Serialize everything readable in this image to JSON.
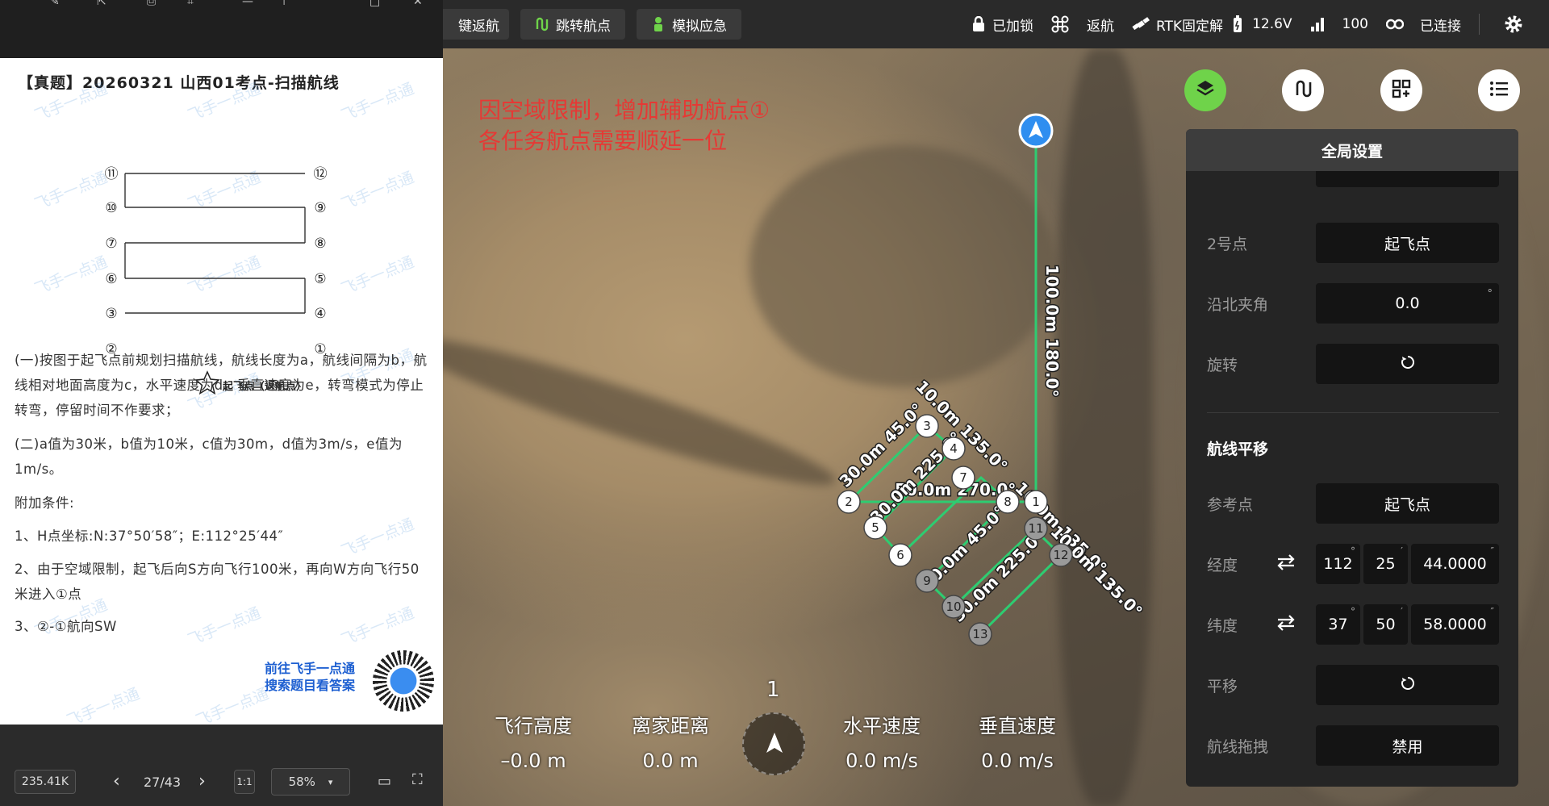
{
  "topbar": {
    "return_home": "键返航",
    "jump_waypoint": "跳转航点",
    "simulate_emergency": "模拟应急",
    "lock_status": "已加锁",
    "return_mode": "返航",
    "rtk_status": "RTK固定解",
    "battery_voltage": "12.6V",
    "signal_value": "100",
    "connection_status": "已连接"
  },
  "doc": {
    "title": "【真题】20260321 山西01考点-扫描航线",
    "takeoff_label": "起飞点（返航点）",
    "diagram_points": [
      "⑪",
      "⑫",
      "⑩",
      "⑨",
      "⑦",
      "⑧",
      "⑥",
      "⑤",
      "③",
      "④",
      "②",
      "①"
    ],
    "watermark": "飞手一点通",
    "paragraphs": [
      "(一)按图于起飞点前规划扫描航线，航线长度为a，航线间隔为b，航线相对地面高度为c，水平速度为d，垂直速度为e，转弯模式为停止转弯，停留时间不作要求；",
      "(二)a值为30米，b值为10米，c值为30m，d值为3m/s，e值为1m/s。",
      "附加条件:",
      "1、H点坐标:N:37°50′58″；E:112°25′44″",
      "2、由于空域限制，起飞后向S方向飞行100米，再向W方向飞行50米进入①点",
      "3、②-①航向SW"
    ],
    "qr_line1": "前往飞手一点通",
    "qr_line2": "搜索题目看答案",
    "file_size": "235.41K",
    "page_indicator": "27/43",
    "zoom": "58%"
  },
  "map_note": {
    "line1": "因空域限制，增加辅助航点①",
    "line2": "各任务航点需要顺延一位"
  },
  "route_labels": {
    "main_leg": "100.0m 180.0°",
    "leg_a": "30.0m 45.0°",
    "leg_b": "10.0m 135.0°",
    "leg_c": "50.0m 270.0°",
    "leg_d": "30.0m 225.0°",
    "leg_e": "10.0m 135.0°",
    "leg_f": "30.0m 45.0°",
    "leg_g": "30.0m 225.0°",
    "leg_h": "10.0m 135.0°"
  },
  "waypoints": [
    "1",
    "2",
    "3",
    "4",
    "5",
    "6",
    "7",
    "8",
    "9",
    "10",
    "11",
    "12",
    "13"
  ],
  "telemetry": {
    "altitude_label": "飞行高度",
    "altitude_value": "–0.0 m",
    "distance_label": "离家距离",
    "distance_value": "0.0 m",
    "hspeed_label": "水平速度",
    "hspeed_value": "0.0 m/s",
    "vspeed_label": "垂直速度",
    "vspeed_value": "0.0 m/s",
    "compass_number": "1"
  },
  "panel": {
    "title": "全局设置",
    "point2_label": "2号点",
    "point2_value": "起飞点",
    "north_angle_label": "沿北夹角",
    "north_angle_value": "0.0",
    "north_angle_unit": "°",
    "rotate_label": "旋转",
    "section_title": "航线平移",
    "ref_label": "参考点",
    "ref_value": "起飞点",
    "lon_label": "经度",
    "lon_deg": "112",
    "lon_min": "25",
    "lon_sec": "44.0000",
    "lat_label": "纬度",
    "lat_deg": "37",
    "lat_min": "50",
    "lat_sec": "58.0000",
    "translate_label": "平移",
    "drag_label": "航线拖拽",
    "drag_value": "禁用"
  },
  "colors": {
    "route_green": "#2ecc71",
    "accent_green": "#6fd34a",
    "note_red": "#e53935",
    "link_blue": "#1d5fd1"
  }
}
